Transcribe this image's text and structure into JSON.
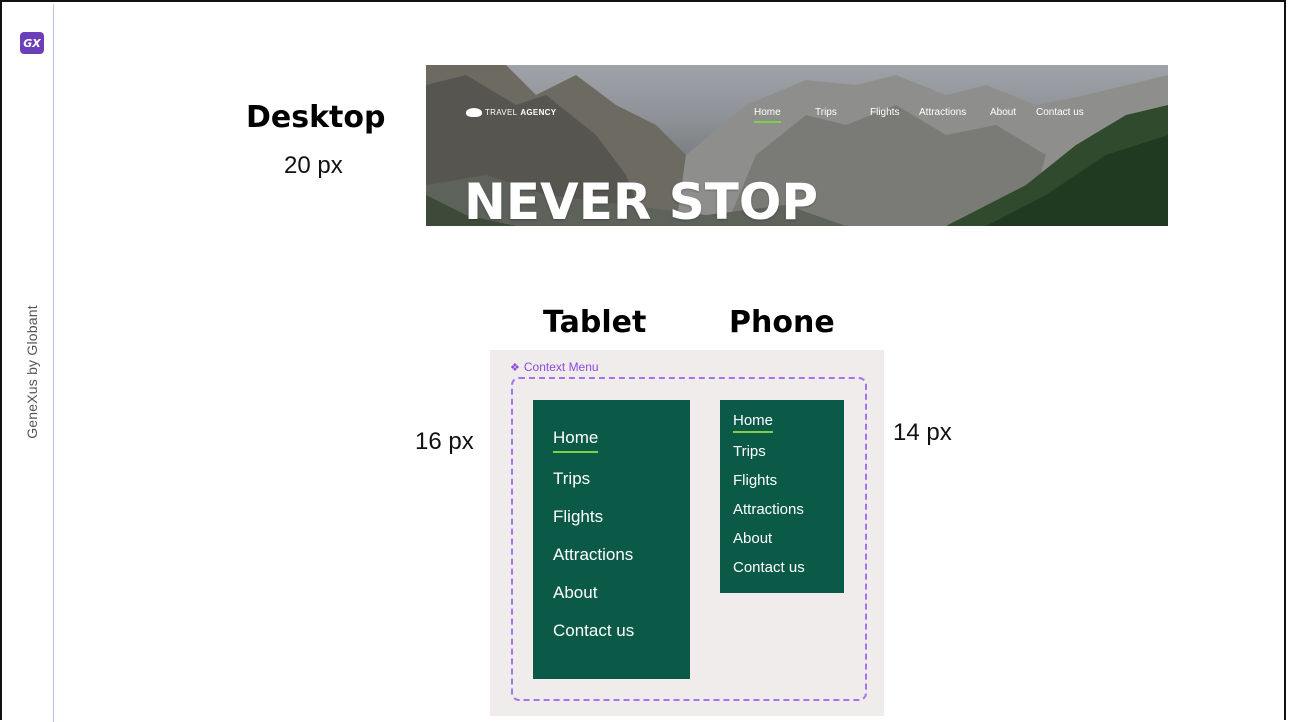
{
  "sidebar": {
    "logo_text": "GX",
    "brand": "GeneXus by Globant"
  },
  "desktop": {
    "label": "Desktop",
    "size": "20 px",
    "banner": {
      "logo_light": "TRAVEL",
      "logo_bold": "AGENCY",
      "nav": [
        "Home",
        "Trips",
        "Flights",
        "Attractions",
        "About",
        "Contact us"
      ],
      "active_index": 0,
      "hero": "NEVER STOP"
    }
  },
  "tablet": {
    "label": "Tablet",
    "size": "16 px",
    "menu": [
      "Home",
      "Trips",
      "Flights",
      "Attractions",
      "About",
      "Contact us"
    ]
  },
  "phone": {
    "label": "Phone",
    "size": "14 px",
    "menu": [
      "Home",
      "Trips",
      "Flights",
      "Attractions",
      "About",
      "Contact us"
    ]
  },
  "context_menu": {
    "title": "Context Menu",
    "icon": "diamond-icon"
  },
  "colors": {
    "menu_bg": "#0b5a47",
    "active_underline": "#7ed04b",
    "context_accent": "#a672f0",
    "gx_logo": "#6b3fb8"
  }
}
